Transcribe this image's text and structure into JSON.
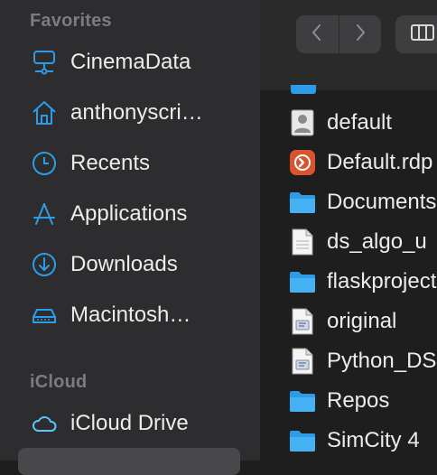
{
  "sidebar": {
    "favorites_header": "Favorites",
    "icloud_header": "iCloud",
    "favorites": [
      {
        "label": "CinemaData",
        "icon": "network-drive-icon"
      },
      {
        "label": "anthonyscri…",
        "icon": "home-icon"
      },
      {
        "label": "Recents",
        "icon": "clock-icon"
      },
      {
        "label": "Applications",
        "icon": "applications-icon"
      },
      {
        "label": "Downloads",
        "icon": "download-icon"
      },
      {
        "label": "Macintosh…",
        "icon": "hard-drive-icon"
      }
    ],
    "icloud": [
      {
        "label": "iCloud Drive",
        "icon": "cloud-icon"
      }
    ]
  },
  "toolbar": {
    "back_icon": "chevron-left-icon",
    "forward_icon": "chevron-right-icon",
    "view_icon": "column-view-icon"
  },
  "files": [
    {
      "name": "default",
      "icon": "contact-file-icon"
    },
    {
      "name": "Default.rdp",
      "icon": "remote-desktop-icon"
    },
    {
      "name": "Documents",
      "icon": "folder-icon"
    },
    {
      "name": "ds_algo_u",
      "icon": "document-icon"
    },
    {
      "name": "flaskproject",
      "icon": "folder-icon"
    },
    {
      "name": "original",
      "icon": "script-file-icon"
    },
    {
      "name": "Python_DS",
      "icon": "script-file-icon"
    },
    {
      "name": "Repos",
      "icon": "folder-icon"
    },
    {
      "name": "SimCity 4",
      "icon": "folder-icon"
    }
  ],
  "colors": {
    "accent": "#2e9be6",
    "sidebar_bg": "#2d2d2f",
    "main_bg": "#1e1e1e",
    "rdp_red": "#d9532f"
  }
}
